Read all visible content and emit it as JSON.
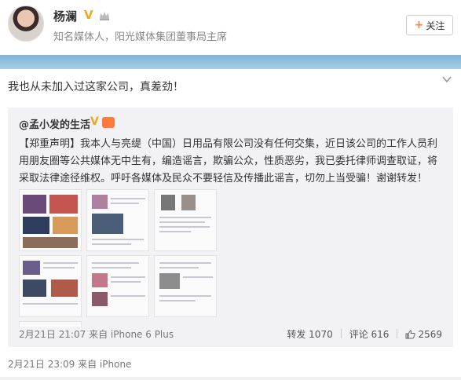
{
  "author": {
    "name": "杨澜",
    "title": "知名媒体人，阳光媒体集团董事局主席",
    "follow_label": "关注"
  },
  "post": {
    "text": "我也从未加入过这家公司，真差劲！",
    "time": "2月21日 23:09 来自 iPhone"
  },
  "repost": {
    "author": "@孟小发的生活",
    "body": "【郑重声明】我本人与亮缇（中国）日用品有限公司没有任何交集，近日该公司的工作人员利用朋友圈等公共媒体无中生有，编造谣言，欺骗公众，性质恶劣，我已委托律师调查取证，将采取法律途径维权。呼吁各媒体及民众不要轻信及传播此谣言，切勿上当受骗！谢谢转发！",
    "time": "2月21日 21:07 来自 iPhone 6 Plus",
    "repost_label": "转发 1070",
    "comment_label": "评论 616",
    "like_count": "2569"
  },
  "colors": {
    "verified": "#f2a81a",
    "accent": "#ff8140",
    "band": "#7fb4d8"
  },
  "icons": [
    "verified-v-icon",
    "crown-icon",
    "plus-icon",
    "chevron-down-icon",
    "thumb-up-icon"
  ]
}
